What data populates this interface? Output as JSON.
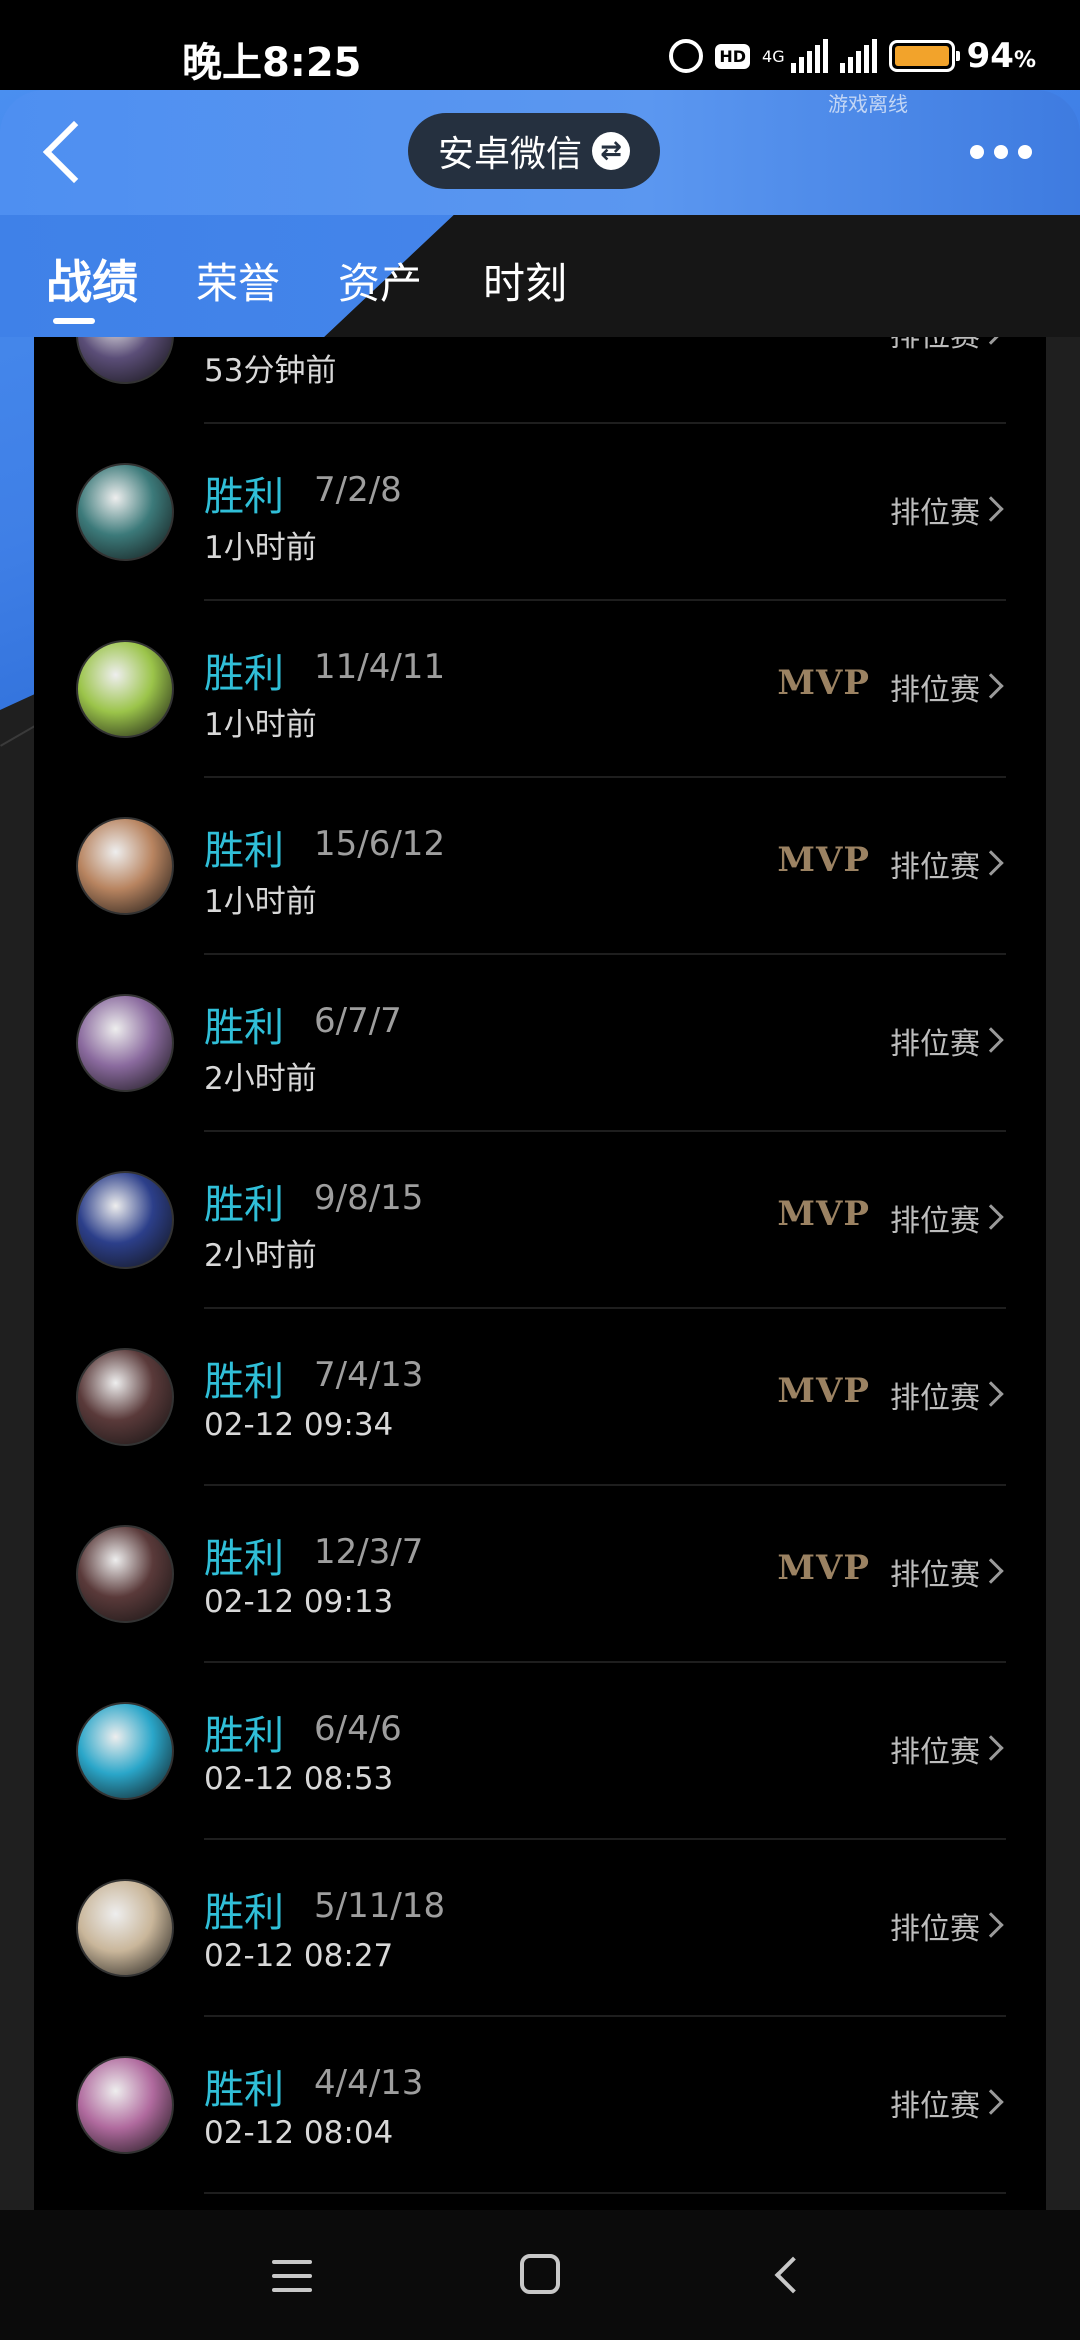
{
  "status_bar": {
    "time": "晚上8:25",
    "network": "4G",
    "hd": "HD",
    "battery_percent": "94",
    "battery_unit": "%"
  },
  "header": {
    "account_label": "安卓微信",
    "offline_text": "游戏离线"
  },
  "tabs": [
    {
      "label": "战绩",
      "active": true
    },
    {
      "label": "荣誉",
      "active": false
    },
    {
      "label": "资产",
      "active": false
    },
    {
      "label": "时刻",
      "active": false
    }
  ],
  "matches": [
    {
      "result": "",
      "kda": "",
      "time": "53分钟前",
      "mvp": "",
      "mode": "排位赛",
      "avatar_color": "#5b4e78"
    },
    {
      "result": "胜利",
      "kda": "7/2/8",
      "time": "1小时前",
      "mvp": "",
      "mode": "排位赛",
      "avatar_color": "#3c7a7a"
    },
    {
      "result": "胜利",
      "kda": "11/4/11",
      "time": "1小时前",
      "mvp": "MVP",
      "mode": "排位赛",
      "avatar_color": "#9bc44a"
    },
    {
      "result": "胜利",
      "kda": "15/6/12",
      "time": "1小时前",
      "mvp": "MVP",
      "mode": "排位赛",
      "avatar_color": "#b88460"
    },
    {
      "result": "胜利",
      "kda": "6/7/7",
      "time": "2小时前",
      "mvp": "",
      "mode": "排位赛",
      "avatar_color": "#8a6a9e"
    },
    {
      "result": "胜利",
      "kda": "9/8/15",
      "time": "2小时前",
      "mvp": "MVP",
      "mode": "排位赛",
      "avatar_color": "#2c3f8a"
    },
    {
      "result": "胜利",
      "kda": "7/4/13",
      "time": "02-12 09:34",
      "mvp": "MVP",
      "mode": "排位赛",
      "avatar_color": "#5a3a3a"
    },
    {
      "result": "胜利",
      "kda": "12/3/7",
      "time": "02-12 09:13",
      "mvp": "MVP",
      "mode": "排位赛",
      "avatar_color": "#5a3a3a"
    },
    {
      "result": "胜利",
      "kda": "6/4/6",
      "time": "02-12 08:53",
      "mvp": "",
      "mode": "排位赛",
      "avatar_color": "#2aa6c9"
    },
    {
      "result": "胜利",
      "kda": "5/11/18",
      "time": "02-12 08:27",
      "mvp": "",
      "mode": "排位赛",
      "avatar_color": "#c9b69a"
    },
    {
      "result": "胜利",
      "kda": "4/4/13",
      "time": "02-12 08:04",
      "mvp": "",
      "mode": "排位赛",
      "avatar_color": "#b06a9e"
    }
  ]
}
